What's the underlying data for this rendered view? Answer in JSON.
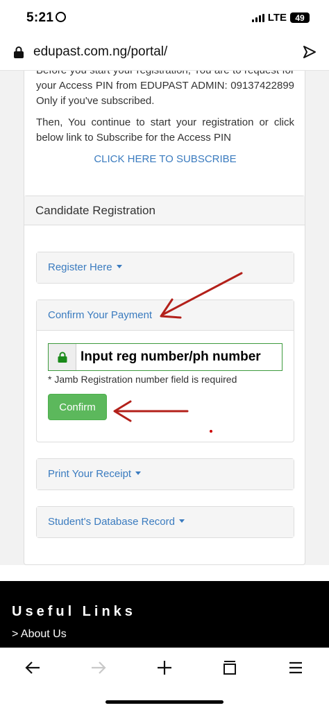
{
  "status_bar": {
    "time": "5:21",
    "network": "LTE",
    "battery": "49"
  },
  "browser": {
    "url": "edupast.com.ng/portal/"
  },
  "intro": {
    "paragraph1": "Before you start your registration, You are to request for your Access PIN from EDUPAST ADMIN: 09137422899 Only if you've subscribed.",
    "paragraph2": "Then, You continue to start your registration or click below link to Subscribe for the Access PIN",
    "subscribe_link": "CLICK HERE TO SUBSCRIBE"
  },
  "registration": {
    "title": "Candidate Registration",
    "panels": [
      {
        "label": "Register Here"
      },
      {
        "label": "Confirm Your Payment"
      },
      {
        "label": "Print Your Receipt"
      },
      {
        "label": "Student's Database Record"
      }
    ],
    "input_value": "Input reg number/ph number",
    "input_placeholder": "Jamb Registration number",
    "error_text": "* Jamb Registration number field is required",
    "confirm_label": "Confirm"
  },
  "footer": {
    "title": "Useful Links",
    "link": "> About Us"
  },
  "colors": {
    "accent_blue": "#3a7bbf",
    "success_green": "#5cb85c",
    "annotation_red": "#b3201a"
  },
  "icons": [
    "lock-icon",
    "share-icon",
    "back-arrow-icon",
    "forward-arrow-icon",
    "plus-icon",
    "tabs-icon",
    "menu-icon"
  ]
}
